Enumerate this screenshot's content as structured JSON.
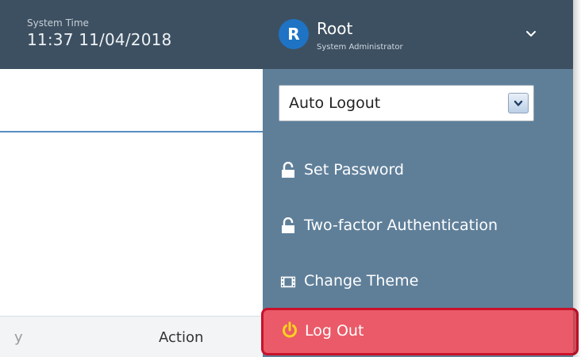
{
  "header": {
    "system_time_label": "System Time",
    "system_time_value": "11:37 11/04/2018",
    "user": {
      "avatar_initial": "R",
      "name": "Root",
      "role": "System Administrator"
    }
  },
  "content": {
    "table_header_truncated": "y",
    "table_header_action": "Action"
  },
  "dropdown": {
    "auto_logout": {
      "selected": "Auto Logout"
    },
    "items": [
      {
        "label": "Set Password",
        "icon": "lock-icon"
      },
      {
        "label": "Two-factor Authentication",
        "icon": "lock-icon"
      },
      {
        "label": "Change Theme",
        "icon": "film-icon"
      },
      {
        "label": "Log Out",
        "icon": "power-icon"
      }
    ]
  },
  "colors": {
    "header_bg": "#3d5061",
    "dropdown_bg": "#5f7f99",
    "avatar_bg": "#1f73c4",
    "logout_bg": "#ea5a68",
    "logout_border": "#c8122a",
    "power_icon": "#ffd21f"
  }
}
